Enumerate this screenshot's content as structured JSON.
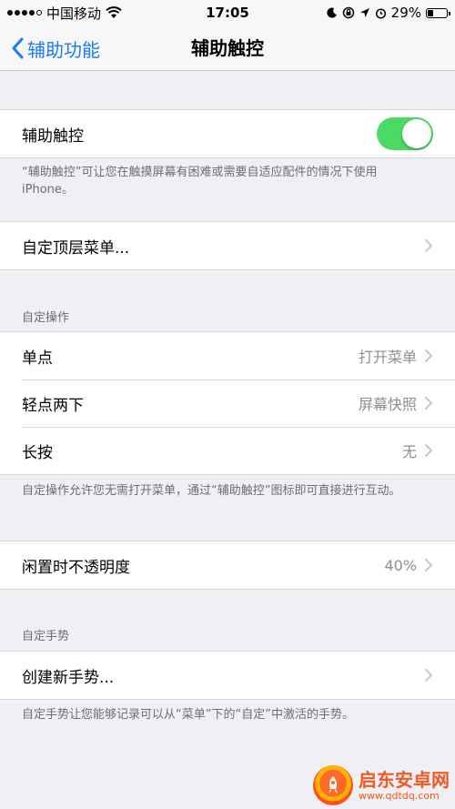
{
  "status_bar": {
    "carrier": "中国移动",
    "time": "17:05",
    "battery_text": "29%",
    "battery_level": 0.29,
    "icons": [
      "signal-icon",
      "wifi-icon",
      "moon-icon",
      "rotation-lock-icon",
      "location-icon",
      "alarm-icon",
      "battery-icon"
    ]
  },
  "nav": {
    "back_label": "辅助功能",
    "title": "辅助触控"
  },
  "main_toggle": {
    "label": "辅助触控",
    "on": true,
    "footnote": "“辅助触控”可让您在触摸屏幕有困难或需要自适应配件的情况下使用 iPhone。"
  },
  "top_menu": {
    "label": "自定顶层菜单..."
  },
  "custom_actions": {
    "header": "自定操作",
    "rows": [
      {
        "label": "单点",
        "value": "打开菜单"
      },
      {
        "label": "轻点两下",
        "value": "屏幕快照"
      },
      {
        "label": "长按",
        "value": "无"
      }
    ],
    "footnote": "自定操作允许您无需打开菜单，通过“辅助触控”图标即可直接进行互动。"
  },
  "idle_opacity": {
    "label": "闲置时不透明度",
    "value": "40%"
  },
  "custom_gestures": {
    "header": "自定手势",
    "create_label": "创建新手势...",
    "footnote": "自定手势让您能够记录可以从“菜单”下的“自定”中激活的手势。"
  },
  "watermark": {
    "title": "启东安卓网",
    "url": "www.qdtdq.com"
  },
  "colors": {
    "accent": "#1a7cf5",
    "toggle_on": "#4cd964",
    "background": "#efeff4"
  }
}
